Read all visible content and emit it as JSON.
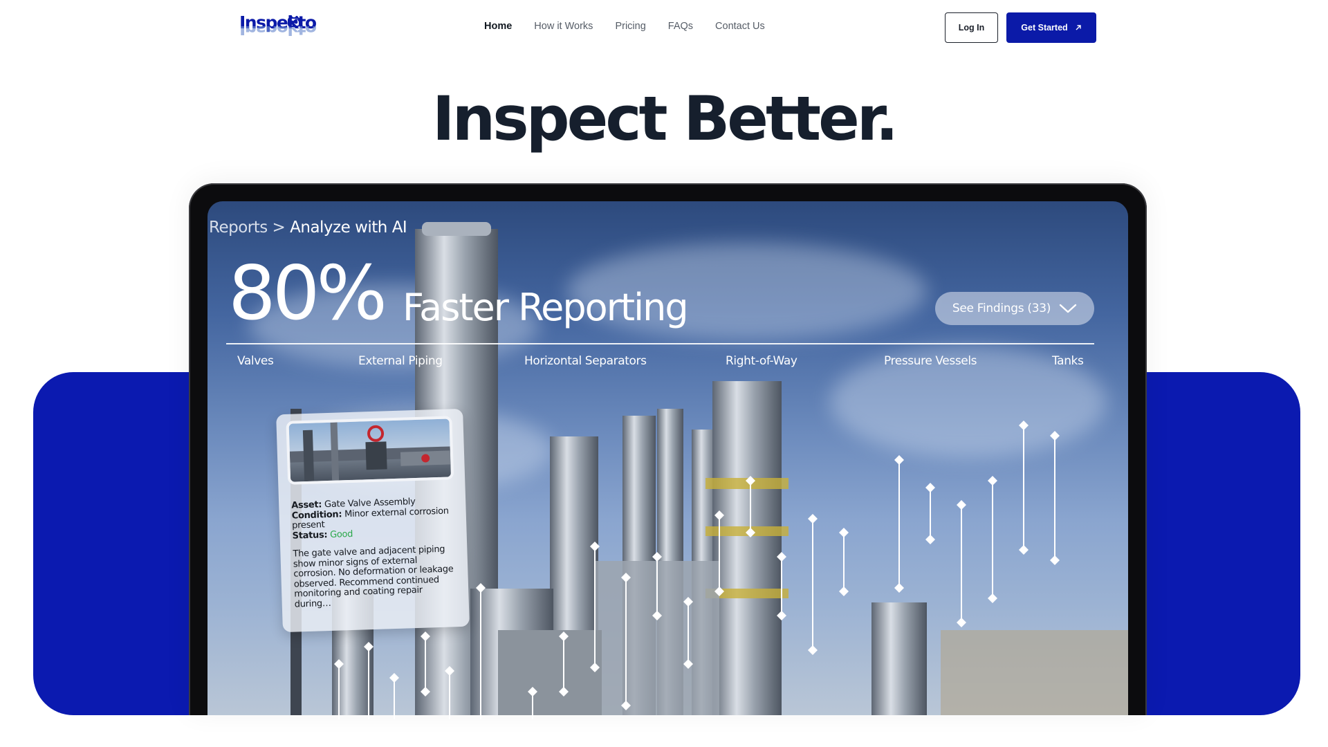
{
  "brand": {
    "name": "Inspekto",
    "colors": {
      "primary": "#0b1aa8",
      "heading": "#161f2d"
    }
  },
  "nav": {
    "items": [
      {
        "label": "Home",
        "active": true
      },
      {
        "label": "How it Works"
      },
      {
        "label": "Pricing"
      },
      {
        "label": "FAQs"
      },
      {
        "label": "Contact Us"
      }
    ],
    "login_label": "Log In",
    "get_started_label": "Get Started",
    "get_started_icon": "arrow-up-right-icon"
  },
  "hero": {
    "title": "Inspect Better."
  },
  "screen": {
    "breadcrumb_parent": "Reports",
    "breadcrumb_sep": " > ",
    "breadcrumb_current": "Analyze with AI",
    "stat_value": "80%",
    "stat_label": "Faster Reporting",
    "findings_button": "See Findings (33)",
    "findings_icon": "chevron-down-icon",
    "tabs": [
      "Valves",
      "External Piping",
      "Horizontal Separators",
      "Right-of-Way",
      "Pressure Vessels",
      "Tanks"
    ]
  },
  "card": {
    "asset_label": "Asset:",
    "asset_value": "Gate Valve Assembly",
    "condition_label": "Condition:",
    "condition_value": "Minor external corrosion present",
    "status_label": "Status:",
    "status_value": "Good",
    "status_color": "#2aa84a",
    "description": "The gate valve and adjacent piping show minor signs of external corrosion. No deformation or leakage observed. Recommend continued monitoring and coating repair during…"
  }
}
